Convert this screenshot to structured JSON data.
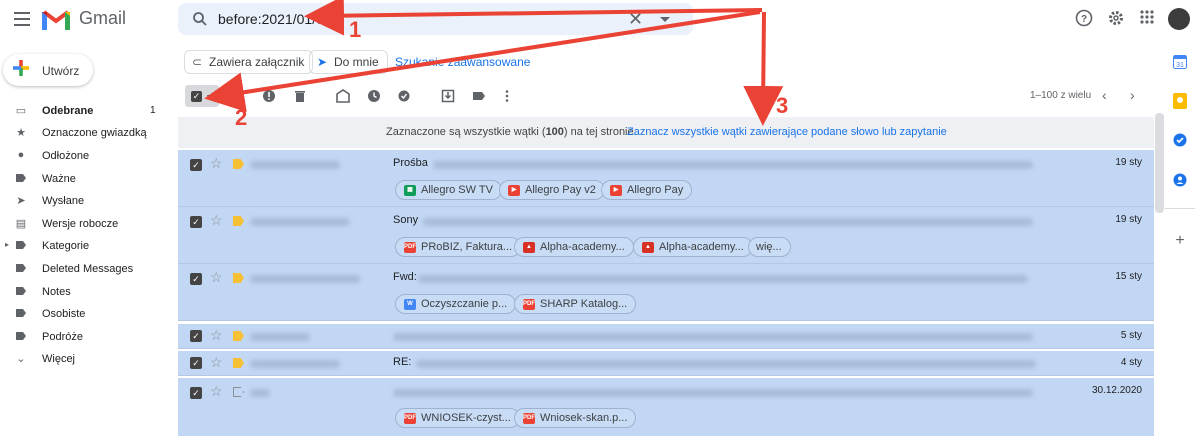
{
  "header": {
    "app_name": "Gmail",
    "search_value": "before:2021/01/01"
  },
  "chips": {
    "has_attachment": "Zawiera załącznik",
    "to_me": "Do mnie",
    "advanced_search": "Szukanie zaawansowane"
  },
  "compose_label": "Utwórz",
  "sidebar": {
    "items": [
      {
        "label": "Odebrane",
        "count": "1",
        "icon": "inbox-icon"
      },
      {
        "label": "Oznaczone gwiazdką",
        "icon": "star-icon"
      },
      {
        "label": "Odłożone",
        "icon": "clock-icon"
      },
      {
        "label": "Ważne",
        "icon": "important-icon"
      },
      {
        "label": "Wysłane",
        "icon": "send-icon"
      },
      {
        "label": "Wersje robocze",
        "icon": "draft-icon"
      },
      {
        "label": "Kategorie",
        "icon": "label-icon"
      },
      {
        "label": "Deleted Messages",
        "icon": "label-icon"
      },
      {
        "label": "Notes",
        "icon": "label-icon"
      },
      {
        "label": "Osobiste",
        "icon": "label-icon"
      },
      {
        "label": "Podróże",
        "icon": "label-icon"
      },
      {
        "label": "Więcej",
        "icon": "chevron-down-icon"
      }
    ]
  },
  "toolbar": {
    "pagination": "1–100 z wielu"
  },
  "banner": {
    "text_prefix": "Zaznaczone są wszystkie wątki (",
    "text_count": "100",
    "text_suffix": ") na tej stronie.",
    "select_all_link": "Zaznacz wszystkie wątki zawierające podane słowo lub zapytanie"
  },
  "mails": [
    {
      "subject": "Prośba",
      "date": "19 sty",
      "important": true,
      "attachments": [
        {
          "name": "Allegro SW TV",
          "type": "sheet"
        },
        {
          "name": "Allegro Pay v2",
          "type": "youtube"
        },
        {
          "name": "Allegro Pay",
          "type": "youtube"
        }
      ]
    },
    {
      "subject": "Sony",
      "date": "19 sty",
      "important": true,
      "attachments": [
        {
          "name": "PRoBIZ, Faktura...",
          "type": "pdf"
        },
        {
          "name": "Alpha-academy...",
          "type": "image"
        },
        {
          "name": "Alpha-academy...",
          "type": "image"
        },
        {
          "name": "wię...",
          "type": "more"
        }
      ]
    },
    {
      "subject": "Fwd:",
      "date": "15 sty",
      "important": true,
      "attachments": [
        {
          "name": "Oczyszczanie p...",
          "type": "doc"
        },
        {
          "name": "SHARP Katalog...",
          "type": "pdf"
        }
      ]
    },
    {
      "subject": "",
      "date": "5 sty",
      "important": true,
      "attachments": []
    },
    {
      "subject": "RE:",
      "date": "4 sty",
      "important": true,
      "attachments": []
    },
    {
      "subject": "",
      "date": "30.12.2020",
      "important": false,
      "attachments": [
        {
          "name": "WNIOSEK-czyst...",
          "type": "pdf"
        },
        {
          "name": "Wniosek-skan.p...",
          "type": "pdf"
        }
      ]
    }
  ],
  "annotations": {
    "label_1": "1",
    "label_2": "2",
    "label_3": "3",
    "arrow_color": "#ea4335"
  }
}
